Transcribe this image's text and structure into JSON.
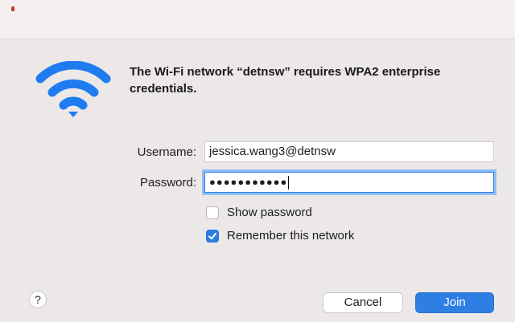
{
  "dialog": {
    "message": "The Wi-Fi network “detnsw” requires WPA2 enterprise credentials.",
    "icon": "wifi-icon",
    "accent_color": "#2f7ee4"
  },
  "form": {
    "username_label": "Username:",
    "username_value": "jessica.wang3@detnsw",
    "password_label": "Password:",
    "password_masked": "●●●●●●●●●●●",
    "show_password_label": "Show password",
    "show_password_checked": false,
    "remember_label": "Remember this network",
    "remember_checked": true
  },
  "buttons": {
    "help_label": "?",
    "cancel_label": "Cancel",
    "join_label": "Join"
  }
}
